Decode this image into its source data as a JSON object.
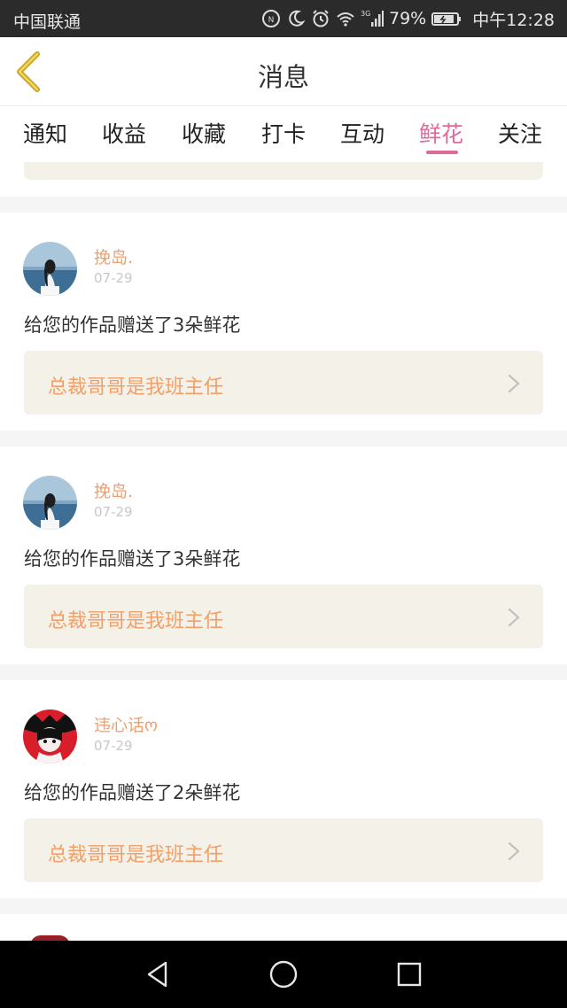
{
  "status_bar": {
    "carrier": "中国联通",
    "network_type": "3G",
    "battery_percent": "79%",
    "time": "中午12:28",
    "icons": [
      "nfc-icon",
      "moon-icon",
      "alarm-icon",
      "wifi-icon",
      "signal-icon",
      "battery-icon"
    ]
  },
  "header": {
    "title": "消息",
    "back_icon": "back-chevron-icon",
    "back_color": "#c9a227"
  },
  "tabs": [
    {
      "label": "通知",
      "active": false
    },
    {
      "label": "收益",
      "active": false
    },
    {
      "label": "收藏",
      "active": false
    },
    {
      "label": "打卡",
      "active": false
    },
    {
      "label": "互动",
      "active": false
    },
    {
      "label": "鲜花",
      "active": true
    },
    {
      "label": "关注",
      "active": false
    }
  ],
  "colors": {
    "active_tab": "#e0699a",
    "username": "#f0a070",
    "link_text": "#f2a06a",
    "link_bg": "#f3f1e8",
    "separator": "#f5f5f5",
    "status_bar": "#2b2b2b"
  },
  "notifications": [
    {
      "user": "挽岛.",
      "date": "07-29",
      "message": "给您的作品赠送了3朵鲜花",
      "work_title": "总裁哥哥是我班主任",
      "avatar": "avatar-girl-seaside"
    },
    {
      "user": "挽岛.",
      "date": "07-29",
      "message": "给您的作品赠送了3朵鲜花",
      "work_title": "总裁哥哥是我班主任",
      "avatar": "avatar-girl-seaside"
    },
    {
      "user": "违心话ო",
      "date": "07-29",
      "message": "给您的作品赠送了2朵鲜花",
      "work_title": "总裁哥哥是我班主任",
      "avatar": "avatar-anime-red"
    }
  ],
  "nav_bar": {
    "icons": [
      "nav-back-icon",
      "nav-home-icon",
      "nav-recents-icon"
    ]
  }
}
